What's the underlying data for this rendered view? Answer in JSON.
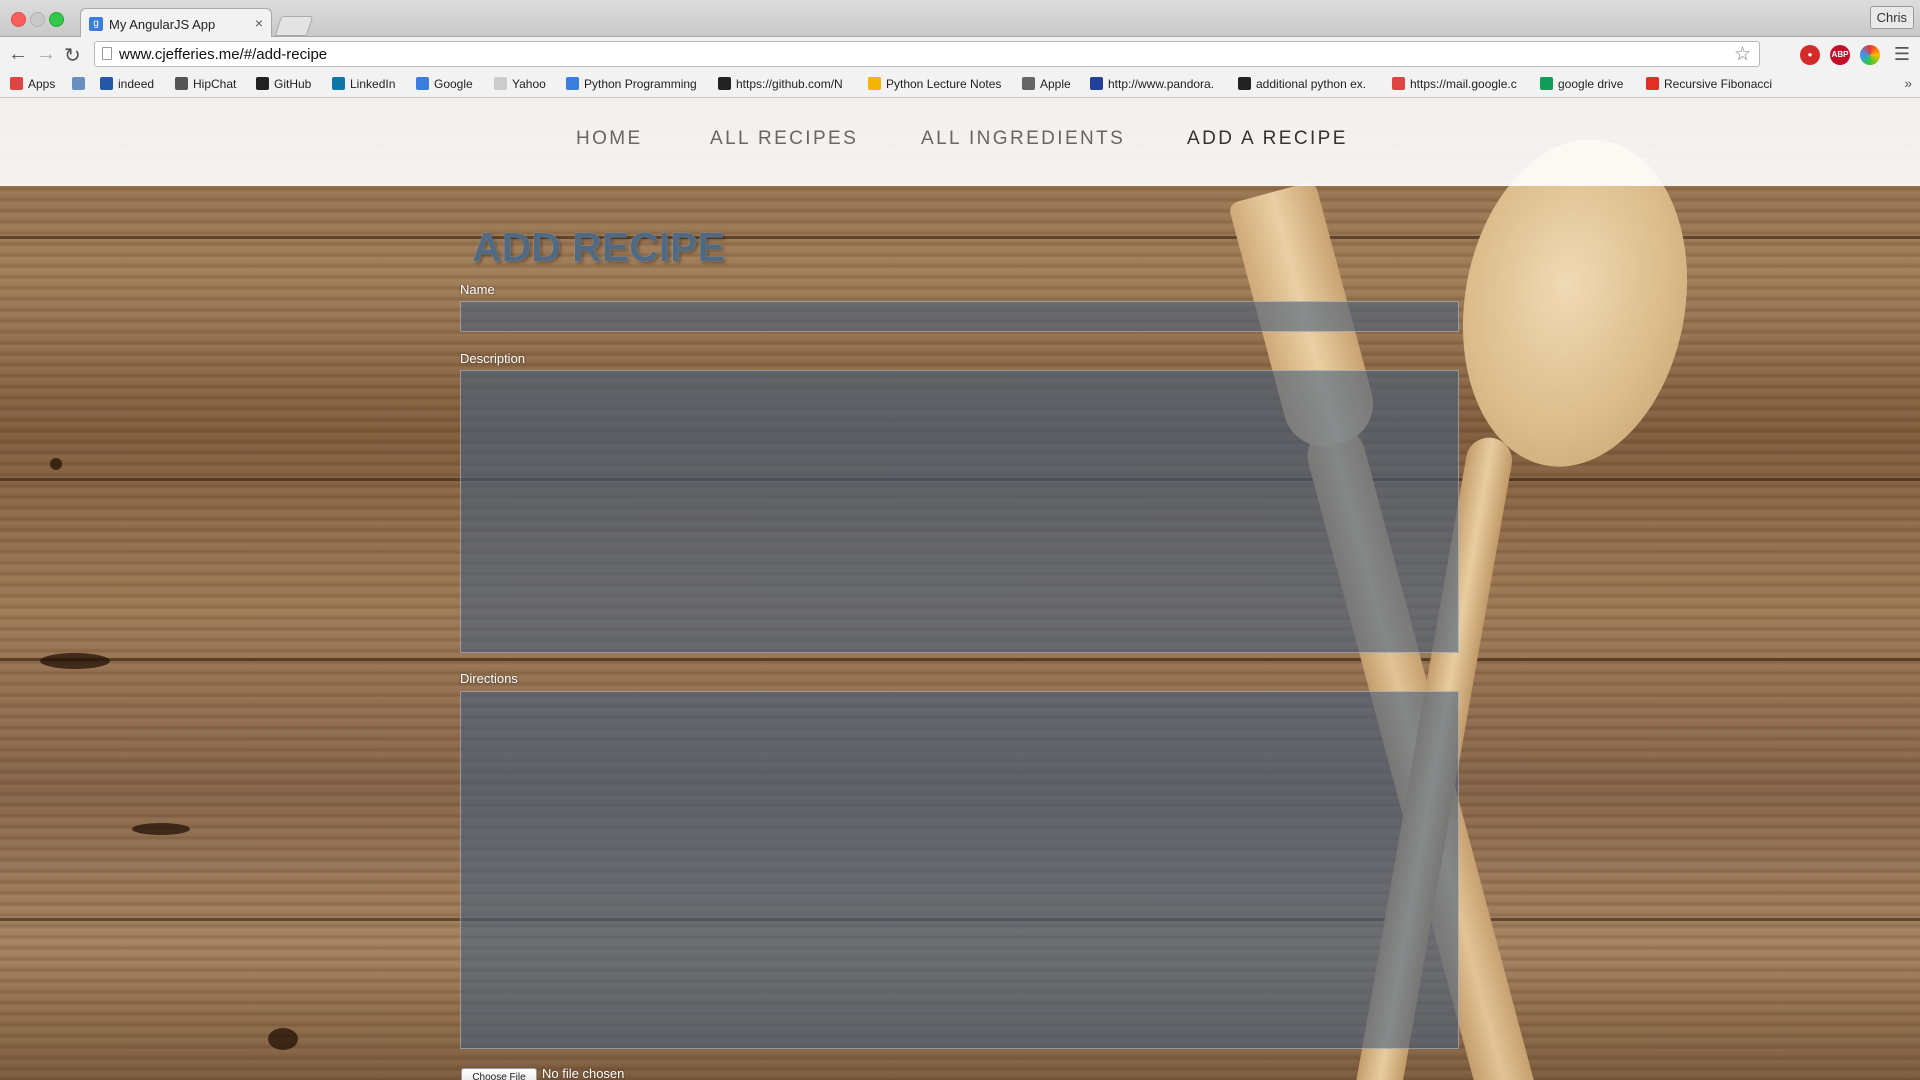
{
  "browser": {
    "tab_title": "My AngularJS App",
    "tab_close": "×",
    "url": "www.cjefferies.me/#/add-recipe",
    "profile_name": "Chris",
    "bookmarks": [
      {
        "label": "Apps",
        "icon": "apps-grid-icon",
        "color": "#d44"
      },
      {
        "label": "",
        "icon": "folder-icon",
        "color": "#6a8fbf"
      },
      {
        "label": "indeed",
        "icon": "indeed-icon",
        "color": "#2557a7"
      },
      {
        "label": "HipChat",
        "icon": "hipchat-icon",
        "color": "#555"
      },
      {
        "label": "GitHub",
        "icon": "github-icon",
        "color": "#222"
      },
      {
        "label": "LinkedIn",
        "icon": "linkedin-icon",
        "color": "#0e76a8"
      },
      {
        "label": "Google",
        "icon": "google-icon",
        "color": "#3b7ddd"
      },
      {
        "label": "Yahoo",
        "icon": "page-icon",
        "color": "#ccc"
      },
      {
        "label": "Python Programming",
        "icon": "python-icon",
        "color": "#3b7ddd"
      },
      {
        "label": "https://github.com/N",
        "icon": "github-icon",
        "color": "#222"
      },
      {
        "label": "Python Lecture Notes",
        "icon": "drive-icon",
        "color": "#f4b400"
      },
      {
        "label": "Apple",
        "icon": "apple-icon",
        "color": "#666"
      },
      {
        "label": "http://www.pandora.",
        "icon": "pandora-icon",
        "color": "#224099"
      },
      {
        "label": "additional python ex.",
        "icon": "github-icon",
        "color": "#222"
      },
      {
        "label": "https://mail.google.c",
        "icon": "gmail-icon",
        "color": "#d44"
      },
      {
        "label": "google drive",
        "icon": "drive-icon",
        "color": "#0f9d58"
      },
      {
        "label": "Recursive Fibonacci",
        "icon": "youtube-icon",
        "color": "#e52d27"
      }
    ],
    "more_bookmarks": "»"
  },
  "nav": {
    "items": [
      "HOME",
      "ALL RECIPES",
      "ALL INGREDIENTS",
      "ADD A RECIPE"
    ],
    "active": "ADD A RECIPE"
  },
  "form": {
    "heading": "ADD RECIPE",
    "name_label": "Name",
    "name_value": "",
    "description_label": "Description",
    "description_value": "",
    "directions_label": "Directions",
    "directions_value": "",
    "file_button": "Choose File",
    "file_status": "No file chosen"
  }
}
